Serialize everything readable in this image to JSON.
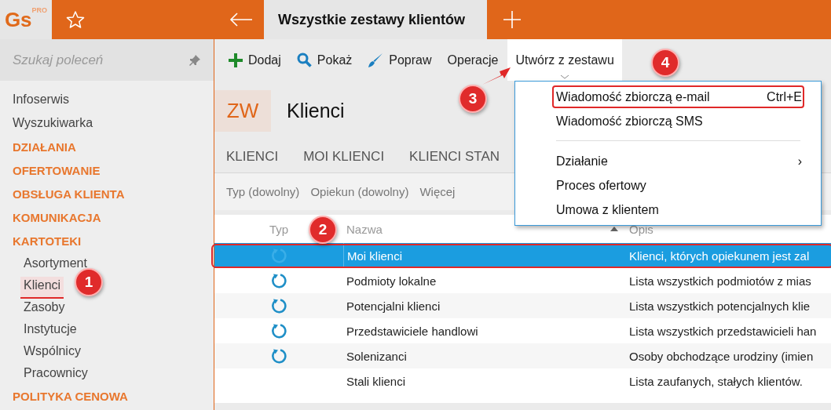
{
  "app": {
    "logo": "Gs",
    "logo_badge": "PRO"
  },
  "tabs": [
    {
      "title": "Wszystkie zestawy klientów",
      "selected": true
    }
  ],
  "sidebar": {
    "search": {
      "placeholder": "Szukaj poleceń"
    },
    "items": [
      {
        "kind": "link",
        "label": "Infoserwis"
      },
      {
        "kind": "link",
        "label": "Wyszukiwarka"
      },
      {
        "kind": "section",
        "label": "DZIAŁANIA"
      },
      {
        "kind": "section",
        "label": "OFERTOWANIE"
      },
      {
        "kind": "section",
        "label": "OBSŁUGA KLIENTA"
      },
      {
        "kind": "section",
        "label": "KOMUNIKACJA"
      },
      {
        "kind": "section",
        "label": "KARTOTEKI",
        "children": [
          {
            "label": "Asortyment",
            "selected": false
          },
          {
            "label": "Klienci",
            "selected": true
          },
          {
            "label": "Zasoby",
            "selected": false
          },
          {
            "label": "Instytucje",
            "selected": false
          },
          {
            "label": "Wspólnicy",
            "selected": false
          },
          {
            "label": "Pracownicy",
            "selected": false
          }
        ]
      },
      {
        "kind": "section",
        "label": "POLITYKA CENOWA"
      }
    ]
  },
  "toolbar": [
    {
      "kind": "add",
      "label": "Dodaj",
      "open": false
    },
    {
      "kind": "search",
      "label": "Pokaż",
      "open": false
    },
    {
      "kind": "edit",
      "label": "Popraw",
      "open": false
    },
    {
      "kind": "none",
      "label": "Operacje",
      "open": false
    },
    {
      "kind": "dropdown",
      "label": "Utwórz z zestawu",
      "open": true
    }
  ],
  "header": {
    "badge": "ZW",
    "title": "Klienci"
  },
  "view_tabs": [
    "KLIENCI",
    "MOI KLIENCI",
    "KLIENCI STAN"
  ],
  "filters": [
    "Typ (dowolny)",
    "Opiekun (dowolny)",
    "Więcej"
  ],
  "table": {
    "columns": [
      {
        "label": "Typ",
        "sorted": false
      },
      {
        "label": "Nazwa",
        "sorted": true
      },
      {
        "label": "Opis",
        "sorted": false
      }
    ],
    "rows": [
      {
        "icon": true,
        "name": "Moi klienci",
        "description": "Klienci, których opiekunem jest zal",
        "selected": true
      },
      {
        "icon": true,
        "name": "Podmioty lokalne",
        "description": "Lista wszystkich podmiotów z mias",
        "selected": false
      },
      {
        "icon": true,
        "name": "Potencjalni klienci",
        "description": "Lista wszystkich potencjalnych klie",
        "selected": false
      },
      {
        "icon": true,
        "name": "Przedstawiciele handlowi",
        "description": "Lista wszystkich przedstawicieli han",
        "selected": false
      },
      {
        "icon": true,
        "name": "Solenizanci",
        "description": "Osoby obchodzące urodziny (imien",
        "selected": false
      },
      {
        "icon": false,
        "name": "Stali klienci",
        "description": "Lista zaufanych, stałych klientów.",
        "selected": false
      }
    ]
  },
  "menu": {
    "items": [
      {
        "kind": "item",
        "label": "Wiadomość zbiorczą e-mail",
        "shortcut": "Ctrl+E"
      },
      {
        "kind": "item",
        "label": "Wiadomość zbiorczą SMS"
      },
      {
        "kind": "separator"
      },
      {
        "kind": "submenu",
        "label": "Działanie",
        "arrow": "›"
      },
      {
        "kind": "item",
        "label": "Proces ofertowy"
      },
      {
        "kind": "item",
        "label": "Umowa z klientem"
      }
    ]
  },
  "callouts": [
    "1",
    "2",
    "3",
    "4"
  ]
}
